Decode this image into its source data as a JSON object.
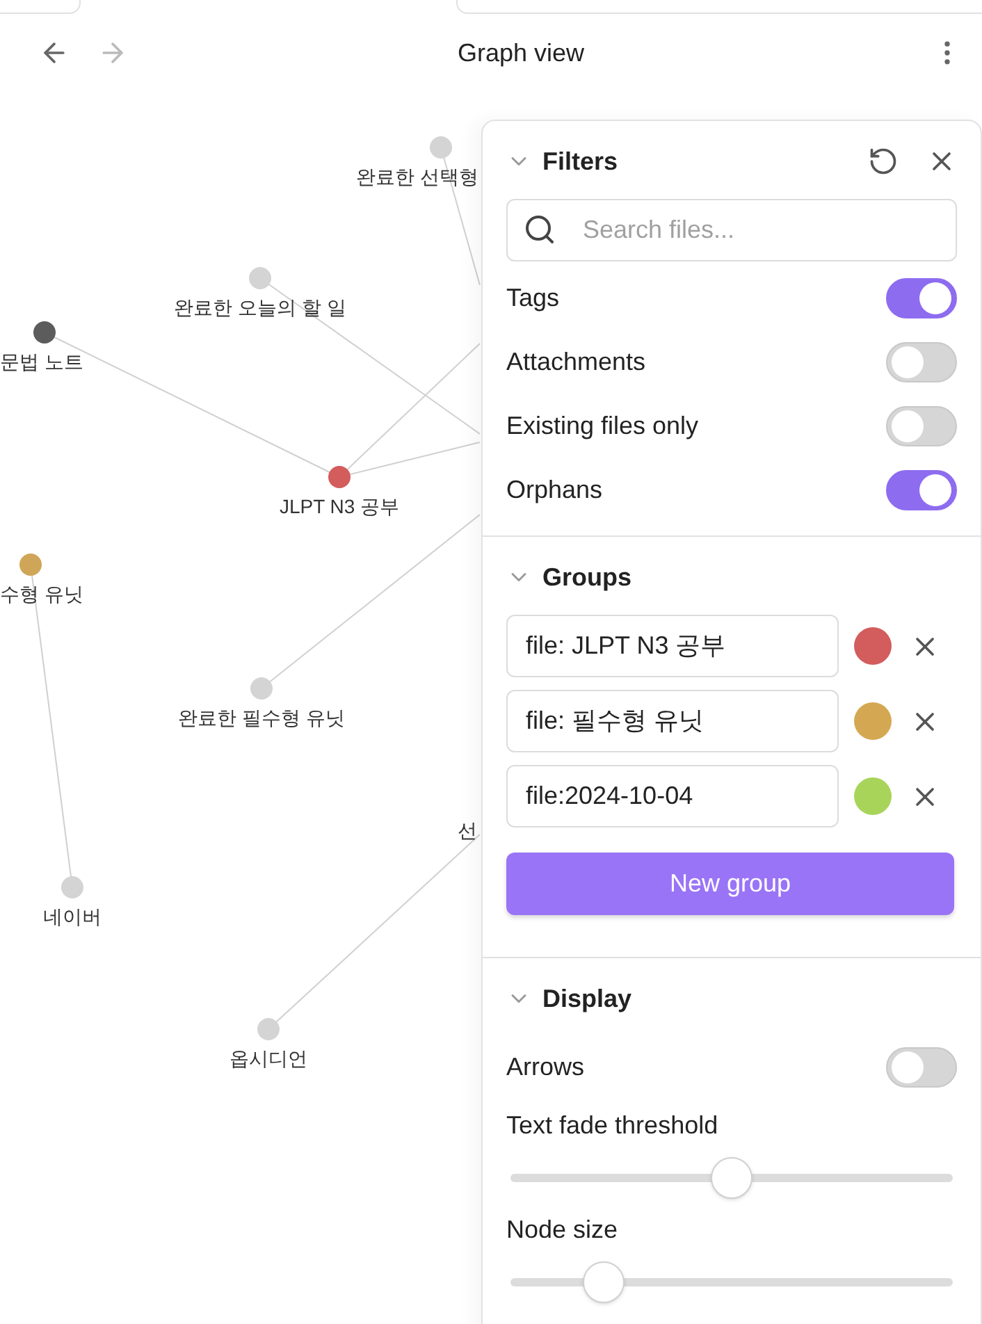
{
  "header": {
    "title": "Graph view",
    "back_disabled": false,
    "forward_disabled": true
  },
  "graph": {
    "nodes": [
      {
        "label": "완료한 선택형",
        "color": "#d4d4d4"
      },
      {
        "label": "완료한 오늘의 할 일",
        "color": "#d4d4d4"
      },
      {
        "label": "문법 노트",
        "color": "#5c5c5c"
      },
      {
        "label": "JLPT N3 공부",
        "color": "#d35c5c"
      },
      {
        "label": "수형 유닛",
        "color": "#cfa557"
      },
      {
        "label": "완료한 필수형 유닛",
        "color": "#d4d4d4"
      },
      {
        "label": "네이버",
        "color": "#d4d4d4"
      },
      {
        "label": "옵시디언",
        "color": "#d4d4d4"
      }
    ],
    "edge_label": "선"
  },
  "panel": {
    "filters": {
      "title": "Filters",
      "expanded": true,
      "search": {
        "placeholder": "Search files..."
      },
      "toggles": [
        {
          "label": "Tags",
          "on": true
        },
        {
          "label": "Attachments",
          "on": false
        },
        {
          "label": "Existing files only",
          "on": false
        },
        {
          "label": "Orphans",
          "on": true
        }
      ]
    },
    "groups": {
      "title": "Groups",
      "expanded": true,
      "items": [
        {
          "query": "file: JLPT N3 공부",
          "color": "#d35c5c"
        },
        {
          "query": "file: 필수형 유닛",
          "color": "#d4a852"
        },
        {
          "query": "file:2024-10-04",
          "color": "#a8d45a"
        }
      ],
      "button": "New group"
    },
    "display": {
      "title": "Display",
      "expanded": true,
      "items": [
        {
          "kind": "toggle",
          "label": "Arrows",
          "on": false
        },
        {
          "kind": "slider",
          "label": "Text fade threshold",
          "level": 0.5
        },
        {
          "kind": "slider",
          "label": "Node size",
          "level": 0.21
        }
      ]
    }
  }
}
